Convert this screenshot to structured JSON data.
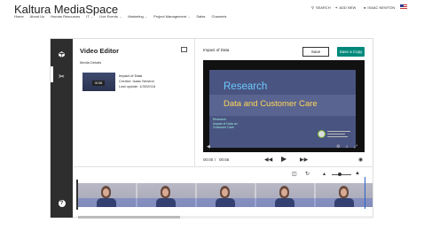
{
  "header": {
    "brand": "Kaltura MediaSpace",
    "search_label": "SEARCH",
    "add_new_label": "ADD NEW",
    "user_name": "ISAAC NEWTON"
  },
  "nav": [
    {
      "label": "Home",
      "has_menu": false
    },
    {
      "label": "About Us",
      "has_menu": false
    },
    {
      "label": "Human Resources",
      "has_menu": false
    },
    {
      "label": "IT",
      "has_menu": true
    },
    {
      "label": "Live Events",
      "has_menu": true
    },
    {
      "label": "Marketing",
      "has_menu": true
    },
    {
      "label": "Project Management",
      "has_menu": true
    },
    {
      "label": "Sales",
      "has_menu": false
    },
    {
      "label": "Channels",
      "has_menu": false
    }
  ],
  "editor": {
    "title": "Video Editor",
    "media_details_label": "Media Details",
    "entry": {
      "name": "Impact of Data",
      "creator": "Creator: Isaac Newton",
      "last_update": "Last update: 1/30/2018",
      "duration": "00:56"
    },
    "preview_title": "Impact of Data",
    "save_label": "Save",
    "save_copy_label": "Save a Copy",
    "current_time": "00:00",
    "total_time": "00:56"
  },
  "slide": {
    "title": "Research",
    "subtitle": "Data and Customer Care",
    "small_lines": [
      "Research",
      "Impact of Data on",
      "Customer Care"
    ]
  },
  "icons": {
    "sidebar": [
      "cube-icon",
      "scissors-icon",
      "help-icon"
    ],
    "accent": "#00897b",
    "sidebar_bg": "#2e2e2e"
  }
}
